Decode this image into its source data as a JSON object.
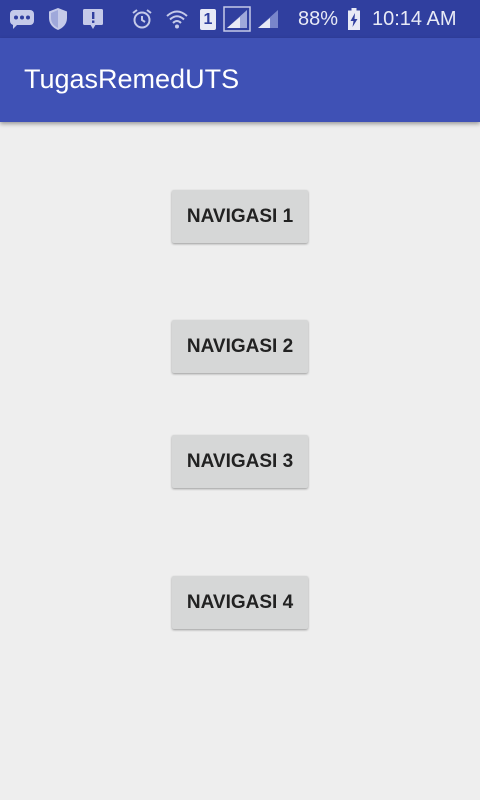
{
  "status_bar": {
    "battery_text": "88%",
    "time": "10:14 AM",
    "sim_badge": "1",
    "icons": [
      "chat-bubble-icon",
      "shield-icon",
      "alert-message-icon",
      "alarm-clock-icon",
      "wifi-icon",
      "sim-card-icon",
      "signal-strength-icon",
      "signal-strength-icon",
      "battery-charging-icon"
    ],
    "color": "#303f9f"
  },
  "app_bar": {
    "title": "TugasRemedUTS",
    "color": "#3f51b5"
  },
  "main": {
    "background": "#eeeeee",
    "buttons": [
      {
        "label": "NAVIGASI 1"
      },
      {
        "label": "NAVIGASI 2"
      },
      {
        "label": "NAVIGASI 3"
      },
      {
        "label": "NAVIGASI 4"
      }
    ]
  }
}
